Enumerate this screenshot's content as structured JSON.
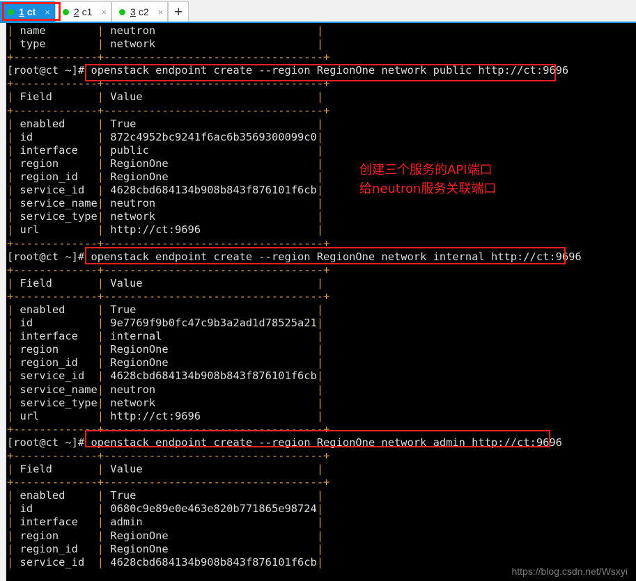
{
  "window": {
    "tabs": [
      {
        "number": "1",
        "label": "ct",
        "close_icon": "×",
        "active": true,
        "highlighted": true
      },
      {
        "number": "2",
        "label": "c1",
        "close_icon": "×",
        "active": false,
        "highlighted": false
      },
      {
        "number": "3",
        "label": "c2",
        "close_icon": "×",
        "active": false,
        "highlighted": false
      }
    ],
    "new_tab_label": "+",
    "active_tab_color": "#1a8fe0",
    "tab_dot_color": "#19c419",
    "highlight_color": "#f22121"
  },
  "terminal": {
    "prompt": "[root@ct ~]# ",
    "separator": "+-------------+----------------------------------+",
    "colors": {
      "background": "#000000",
      "text": "#dcdcdc",
      "pipe": "#cf9b4e",
      "annotation": "#f0202a"
    },
    "commands": {
      "public": "openstack endpoint create --region RegionOne network public http://ct:9696",
      "internal": "openstack endpoint create --region RegionOne network internal http://ct:9696",
      "admin": "openstack endpoint create --region RegionOne network admin http://ct:9696"
    },
    "service_tail": {
      "rows": [
        {
          "field": "name",
          "value": "neutron"
        },
        {
          "field": "type",
          "value": "network"
        }
      ]
    },
    "table_headers": {
      "field": "Field",
      "value": "Value"
    },
    "endpoint_public": {
      "rows": [
        {
          "field": "enabled",
          "value": "True"
        },
        {
          "field": "id",
          "value": "872c4952bc9241f6ac6b3569300099c0"
        },
        {
          "field": "interface",
          "value": "public"
        },
        {
          "field": "region",
          "value": "RegionOne"
        },
        {
          "field": "region_id",
          "value": "RegionOne"
        },
        {
          "field": "service_id",
          "value": "4628cbd684134b908b843f876101f6cb"
        },
        {
          "field": "service_name",
          "value": "neutron"
        },
        {
          "field": "service_type",
          "value": "network"
        },
        {
          "field": "url",
          "value": "http://ct:9696"
        }
      ]
    },
    "endpoint_internal": {
      "rows": [
        {
          "field": "enabled",
          "value": "True"
        },
        {
          "field": "id",
          "value": "9e7769f9b0fc47c9b3a2ad1d78525a21"
        },
        {
          "field": "interface",
          "value": "internal"
        },
        {
          "field": "region",
          "value": "RegionOne"
        },
        {
          "field": "region_id",
          "value": "RegionOne"
        },
        {
          "field": "service_id",
          "value": "4628cbd684134b908b843f876101f6cb"
        },
        {
          "field": "service_name",
          "value": "neutron"
        },
        {
          "field": "service_type",
          "value": "network"
        },
        {
          "field": "url",
          "value": "http://ct:9696"
        }
      ]
    },
    "endpoint_admin": {
      "rows": [
        {
          "field": "enabled",
          "value": "True"
        },
        {
          "field": "id",
          "value": "0680c9e89e0e463e820b771865e98724"
        },
        {
          "field": "interface",
          "value": "admin"
        },
        {
          "field": "region",
          "value": "RegionOne"
        },
        {
          "field": "region_id",
          "value": "RegionOne"
        },
        {
          "field": "service_id",
          "value": "4628cbd684134b908b843f876101f6cb"
        }
      ]
    }
  },
  "annotation": {
    "line1": "创建三个服务的API端口",
    "line2": "给neutron服务关联端口",
    "text": "创建三个服务的API端口\n给neutron服务关联端口"
  },
  "watermark": {
    "text": "https://blog.csdn.net/Wsxyi"
  }
}
